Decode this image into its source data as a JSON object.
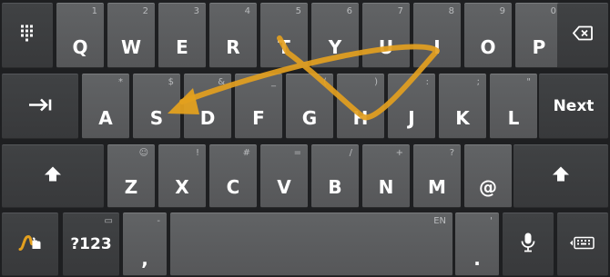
{
  "rows": {
    "row1": [
      {
        "main": "Q",
        "hint": "1"
      },
      {
        "main": "W",
        "hint": "2"
      },
      {
        "main": "E",
        "hint": "3"
      },
      {
        "main": "R",
        "hint": "4"
      },
      {
        "main": "T",
        "hint": "5"
      },
      {
        "main": "Y",
        "hint": "6"
      },
      {
        "main": "U",
        "hint": "7"
      },
      {
        "main": "I",
        "hint": "8"
      },
      {
        "main": "O",
        "hint": "9"
      },
      {
        "main": "P",
        "hint": "0"
      }
    ],
    "row2": [
      {
        "main": "A",
        "hint": "*"
      },
      {
        "main": "S",
        "hint": "$"
      },
      {
        "main": "D",
        "hint": "&"
      },
      {
        "main": "F",
        "hint": "_"
      },
      {
        "main": "G",
        "hint": "("
      },
      {
        "main": "H",
        "hint": ")"
      },
      {
        "main": "J",
        "hint": ":"
      },
      {
        "main": "K",
        "hint": ";"
      },
      {
        "main": "L",
        "hint": "\""
      }
    ],
    "row3": [
      {
        "main": "Z",
        "hint": "☺"
      },
      {
        "main": "X",
        "hint": "!"
      },
      {
        "main": "C",
        "hint": "#"
      },
      {
        "main": "V",
        "hint": "="
      },
      {
        "main": "B",
        "hint": "/"
      },
      {
        "main": "N",
        "hint": "+"
      },
      {
        "main": "M",
        "hint": "?"
      },
      {
        "main": "@",
        "hint": ""
      }
    ]
  },
  "function_keys": {
    "next_label": "Next",
    "symbols_label": "?123",
    "symbols_hint": "▭",
    "comma_label": ",",
    "comma_hint": "-",
    "space_hint": "EN",
    "period_label": ".",
    "period_hint": "'"
  },
  "icons": {
    "numpad": "numpad-grid-icon",
    "backspace": "backspace-icon",
    "tab": "tab-icon",
    "shift": "shift-icon",
    "gesture": "gesture-typing-icon",
    "mic": "microphone-icon",
    "hide": "hide-keyboard-icon"
  },
  "gesture_trail": {
    "path": [
      "T",
      "U",
      "H",
      "S"
    ],
    "color": "#e3a01f"
  }
}
